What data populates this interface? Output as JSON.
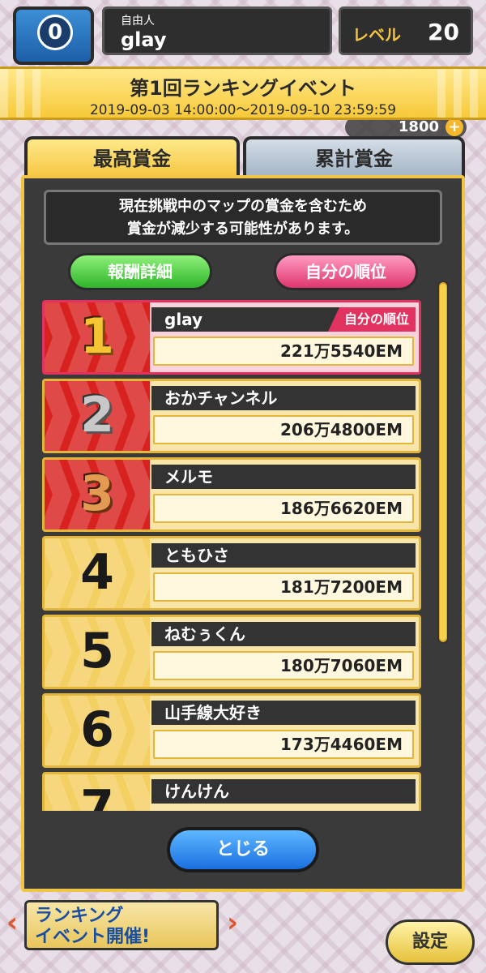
{
  "hud": {
    "level_badge_num": "0",
    "player_title": "自由人",
    "player_name": "glay",
    "level_label": "レベル",
    "level_value": "20",
    "coins": "1800",
    "coin_plus": "+"
  },
  "event": {
    "title": "第1回ランキングイベント",
    "period": "2019-09-03 14:00:00～2019-09-10 23:59:59"
  },
  "tabs": {
    "active": "最高賞金",
    "inactive": "累計賞金"
  },
  "notice": {
    "line1": "現在挑戦中のマップの賞金を含むため",
    "line2": "賞金が減少する可能性があります。"
  },
  "buttons": {
    "reward_detail": "報酬詳細",
    "my_rank": "自分の順位",
    "close": "とじる"
  },
  "ranking": [
    {
      "rank": "1",
      "name": "glay",
      "score": "221万5540EM",
      "mine_tag": "自分の順位"
    },
    {
      "rank": "2",
      "name": "おかチャンネル",
      "score": "206万4800EM"
    },
    {
      "rank": "3",
      "name": "メルモ",
      "score": "186万6620EM"
    },
    {
      "rank": "4",
      "name": "ともひさ",
      "score": "181万7200EM"
    },
    {
      "rank": "5",
      "name": "ねむぅくん",
      "score": "180万7060EM"
    },
    {
      "rank": "6",
      "name": "山手線大好き",
      "score": "173万4460EM"
    },
    {
      "rank": "7",
      "name": "けんけん",
      "score": ""
    }
  ],
  "background": {
    "banner_line1": "ランキング",
    "banner_line2": "イベント開催!",
    "settings": "設定"
  }
}
